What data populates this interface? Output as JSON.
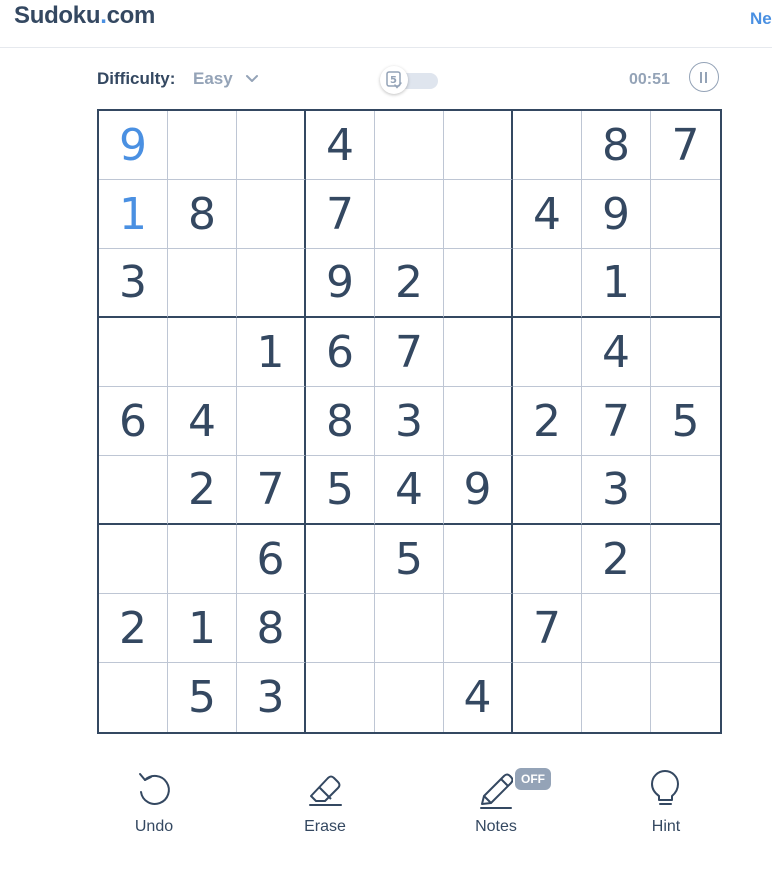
{
  "header": {
    "logo_main": "Sudoku",
    "logo_dot": ".",
    "logo_tld": "com",
    "top_link": "Ne"
  },
  "status": {
    "difficulty_label": "Difficulty:",
    "difficulty_value": "Easy",
    "mistake_limit_badge": "5",
    "timer": "00:51"
  },
  "board": {
    "cells": [
      [
        "9",
        "",
        "",
        "4",
        "",
        "",
        "",
        "8",
        "7"
      ],
      [
        "1",
        "8",
        "",
        "7",
        "",
        "",
        "4",
        "9",
        ""
      ],
      [
        "3",
        "",
        "",
        "9",
        "2",
        "",
        "",
        "1",
        ""
      ],
      [
        "",
        "",
        "1",
        "6",
        "7",
        "",
        "",
        "4",
        ""
      ],
      [
        "6",
        "4",
        "",
        "8",
        "3",
        "",
        "2",
        "7",
        "5"
      ],
      [
        "",
        "2",
        "7",
        "5",
        "4",
        "9",
        "",
        "3",
        ""
      ],
      [
        "",
        "",
        "6",
        "",
        "5",
        "",
        "",
        "2",
        ""
      ],
      [
        "2",
        "1",
        "8",
        "",
        "",
        "",
        "7",
        "",
        ""
      ],
      [
        "",
        "5",
        "3",
        "",
        "",
        "4",
        "",
        "",
        ""
      ]
    ],
    "user_entered": [
      [
        0,
        0
      ],
      [
        1,
        0
      ]
    ]
  },
  "controls": {
    "undo_label": "Undo",
    "erase_label": "Erase",
    "notes_label": "Notes",
    "notes_state": "OFF",
    "hint_label": "Hint"
  },
  "colors": {
    "given_digit": "#344861",
    "entered_digit": "#4a90e2",
    "muted": "#94a3b7",
    "accent": "#4a90e2"
  }
}
